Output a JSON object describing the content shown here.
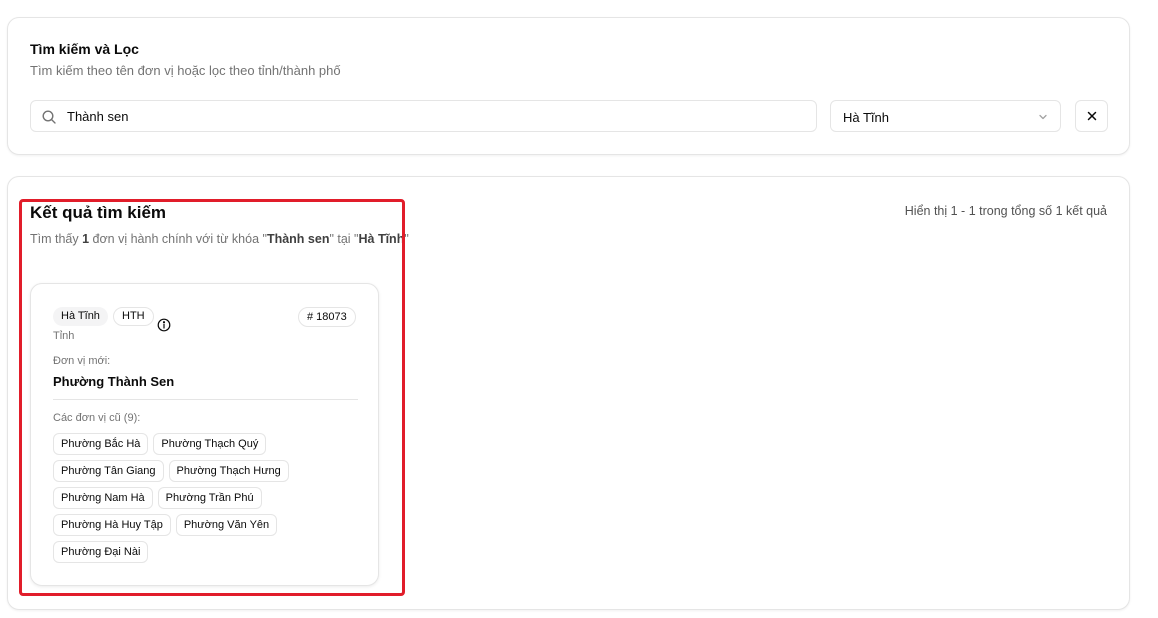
{
  "search_card": {
    "title": "Tìm kiếm và Lọc",
    "subtitle": "Tìm kiếm theo tên đơn vị hoặc lọc theo tỉnh/thành phố",
    "search_value": "Thành sen",
    "search_icon": "search-icon",
    "province_select": "Hà Tĩnh",
    "clear_icon": "close-icon"
  },
  "results": {
    "title": "Kết quả tìm kiếm",
    "desc_prefix": "Tìm thấy ",
    "count": "1",
    "desc_mid": " đơn vị hành chính với từ khóa \"",
    "keyword": "Thành sen",
    "desc_mid2": "\" tại \"",
    "province": "Hà Tĩnh",
    "desc_suffix": "\"",
    "summary": "Hiển thị 1 - 1 trong tổng số 1 kết quả",
    "highlight_color": "#e11d2a"
  },
  "unit": {
    "province_name": "Hà Tĩnh",
    "province_code": "HTH",
    "level": "Tỉnh",
    "id": "# 18073",
    "new_unit_label": "Đơn vị mới:",
    "new_unit_name": "Phường Thành Sen",
    "old_units_label": "Các đơn vị cũ (9):",
    "old_units": [
      "Phường Bắc Hà",
      "Phường Thạch Quý",
      "Phường Tân Giang",
      "Phường Thạch Hưng",
      "Phường Nam Hà",
      "Phường Trần Phú",
      "Phường Hà Huy Tập",
      "Phường Văn Yên",
      "Phường Đại Nài"
    ]
  }
}
